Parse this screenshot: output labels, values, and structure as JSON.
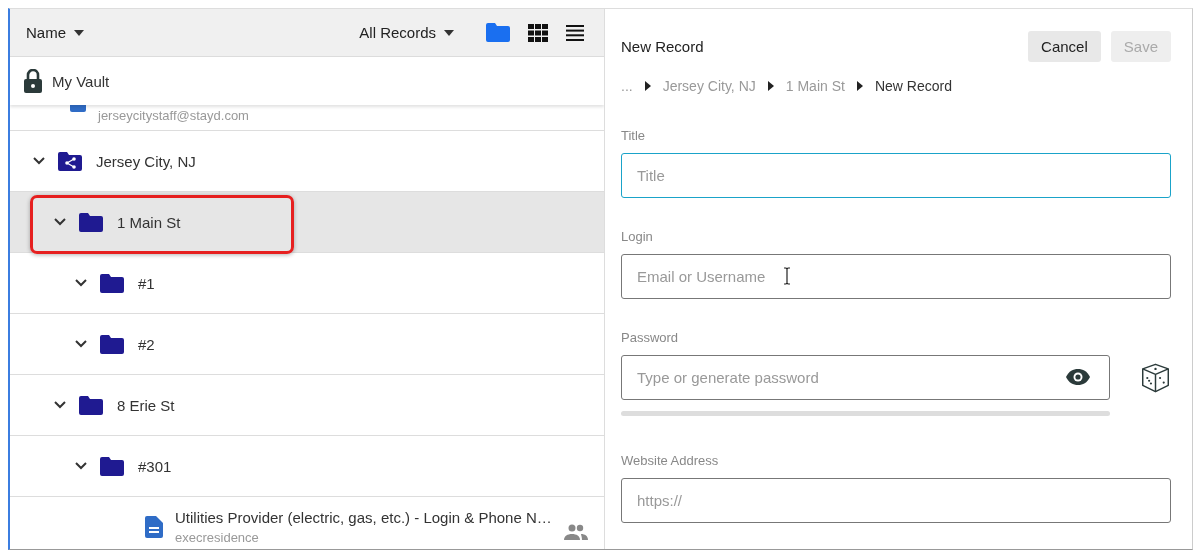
{
  "toolbar": {
    "sort": "Name",
    "filter": "All Records",
    "views": [
      {
        "kind": "folder",
        "selected": true
      },
      {
        "kind": "grid",
        "selected": false
      },
      {
        "kind": "list",
        "selected": false
      }
    ]
  },
  "vault": {
    "label": "My Vault"
  },
  "partial_record": {
    "subtitle": "jerseycitystaff@stayd.com"
  },
  "tree": [
    {
      "kind": "shared-folder",
      "label": "Jersey City, NJ",
      "expanded": true,
      "selected": false,
      "highlighted": false,
      "children": [
        {
          "kind": "folder",
          "label": "1 Main St",
          "expanded": true,
          "selected": true,
          "highlighted": true,
          "children": [
            {
              "kind": "folder",
              "label": "#1",
              "expanded": true,
              "selected": false,
              "highlighted": false
            },
            {
              "kind": "folder",
              "label": "#2",
              "expanded": true,
              "selected": false,
              "highlighted": false
            }
          ]
        },
        {
          "kind": "folder",
          "label": "8 Erie St",
          "expanded": true,
          "selected": false,
          "highlighted": false,
          "children": [
            {
              "kind": "folder",
              "label": "#301",
              "expanded": true,
              "selected": false,
              "highlighted": false,
              "children": [
                {
                  "kind": "record",
                  "label": "Utilities Provider (electric, gas, etc.) - Login & Phone N…",
                  "subtitle": "execresidence",
                  "shared": true,
                  "selected": false,
                  "highlighted": false
                }
              ]
            }
          ]
        }
      ]
    }
  ],
  "form": {
    "title": "New Record",
    "buttons": [
      {
        "label": "Cancel",
        "disabled": false
      },
      {
        "label": "Save",
        "disabled": true
      }
    ],
    "breadcrumb": [
      {
        "label": "...",
        "current": false
      },
      {
        "label": "Jersey City, NJ",
        "current": false
      },
      {
        "label": "1 Main St",
        "current": false
      },
      {
        "label": "New Record",
        "current": true
      }
    ],
    "fields": [
      {
        "kind": "text",
        "label": "Title",
        "placeholder": "Title",
        "focused": true
      },
      {
        "kind": "text",
        "label": "Login",
        "placeholder": "Email or Username",
        "focused": false
      },
      {
        "kind": "password",
        "label": "Password",
        "placeholder": "Type or generate password",
        "focused": false
      },
      {
        "kind": "text",
        "label": "Website Address",
        "placeholder": "https://",
        "focused": false
      }
    ]
  }
}
